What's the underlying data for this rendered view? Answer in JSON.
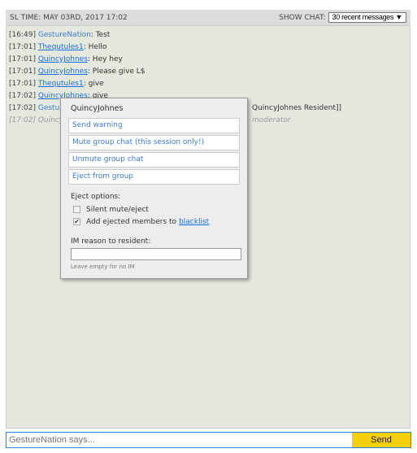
{
  "header": {
    "sl_time": "SL TIME: MAY 03RD, 2017 17:02",
    "show_chat_label": "SHOW CHAT:",
    "show_chat_value": "30 recent messages ▼"
  },
  "messages": [
    {
      "time": "[16:49]",
      "name": "GestureNation",
      "text": ": Test",
      "link": false
    },
    {
      "time": "[17:01]",
      "name": "Thequtules1",
      "text": ": Hello",
      "link": true
    },
    {
      "time": "[17:01]",
      "name": "QuincyJohnes",
      "text": ": Hey hey",
      "link": true
    },
    {
      "time": "[17:01]",
      "name": "QuincyJohnes",
      "text": ": Please give L$",
      "link": true
    },
    {
      "time": "[17:01]",
      "name": "Thequtules1",
      "text": ": give",
      "link": true
    },
    {
      "time": "[17:02]",
      "name": "QuincyJohnes",
      "text": ": give",
      "link": true
    }
  ],
  "partial": [
    {
      "time": "[17:02]",
      "name": "Gestur",
      "tail": "QuincyJohnes Resident]]"
    },
    {
      "time": "[17:02]",
      "name": "Quincy",
      "tail": "moderator"
    }
  ],
  "popup": {
    "title": "QuincyJohnes",
    "buttons": [
      "Send warning",
      "Mute group chat (this session only!)",
      "Unmute group chat",
      "Eject from group"
    ],
    "eject_label": "Eject options:",
    "silent": "Silent mute/eject",
    "silent_checked": false,
    "add_blacklist": "Add ejected members to",
    "blacklist_link": "blacklist",
    "add_blacklist_checked": true,
    "im_label": "IM reason to resident:",
    "im_value": "",
    "hint": "Leave empty for no IM"
  },
  "input": {
    "placeholder": "GestureNation says...",
    "value": "",
    "send": "Send"
  },
  "colors": {
    "accent": "#3a7bd5",
    "send": "#f5cf0a",
    "chat_bg": "#e5e8de"
  }
}
